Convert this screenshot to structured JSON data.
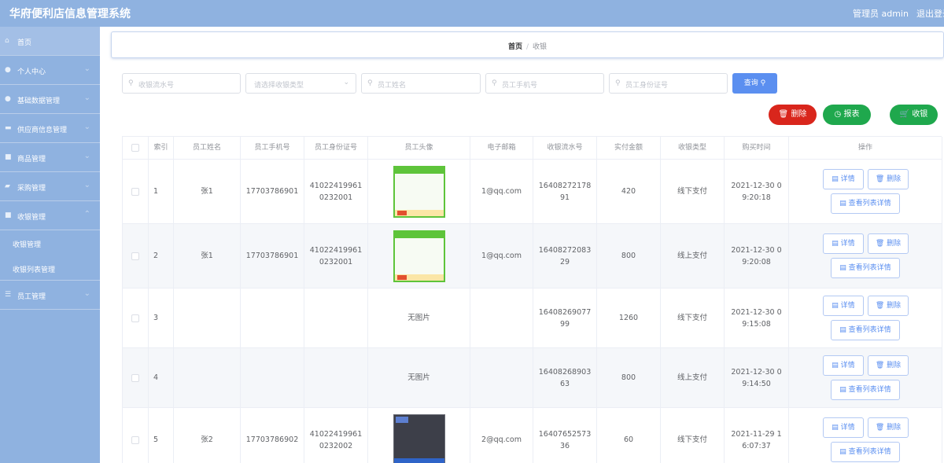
{
  "header": {
    "title": "华府便利店信息管理系统",
    "user": "管理员 admin",
    "logout": "退出登录"
  },
  "sidebar": {
    "items": [
      {
        "label": "首页"
      },
      {
        "label": "个人中心"
      },
      {
        "label": "基础数据管理"
      },
      {
        "label": "供应商信息管理"
      },
      {
        "label": "商品管理"
      },
      {
        "label": "采购管理"
      },
      {
        "label": "收银管理"
      },
      {
        "label": "员工管理"
      }
    ],
    "sub_items": [
      {
        "label": "收银管理"
      },
      {
        "label": "收银列表管理"
      }
    ]
  },
  "breadcrumb": {
    "home": "首页",
    "separator": "/",
    "current": "收银"
  },
  "search": {
    "serial_placeholder": "收银流水号",
    "type_placeholder": "请选择收银类型",
    "name_placeholder": "员工姓名",
    "phone_placeholder": "员工手机号",
    "id_placeholder": "员工身份证号",
    "query_label": "查询"
  },
  "toolbar": {
    "delete_label": "删除",
    "report_label": "报表",
    "pay_label": "收银"
  },
  "table": {
    "columns": [
      "索引",
      "员工姓名",
      "员工手机号",
      "员工身份证号",
      "员工头像",
      "电子邮箱",
      "收银流水号",
      "实付金额",
      "收银类型",
      "购买时间",
      "操作"
    ],
    "rows": [
      {
        "index": "1",
        "name": "张1",
        "phone": "17703786901",
        "id_card": "410224199610232001",
        "avatar": "",
        "email": "1@qq.com",
        "serial": "1640827217891",
        "amount": "420",
        "type": "线下支付",
        "time": "2021-12-30 09:20:18"
      },
      {
        "index": "2",
        "name": "张1",
        "phone": "17703786901",
        "id_card": "410224199610232001",
        "avatar": "",
        "email": "1@qq.com",
        "serial": "1640827208329",
        "amount": "800",
        "type": "线上支付",
        "time": "2021-12-30 09:20:08"
      },
      {
        "index": "3",
        "name": "",
        "phone": "",
        "id_card": "",
        "avatar": "无图片",
        "email": "",
        "serial": "1640826907799",
        "amount": "1260",
        "type": "线下支付",
        "time": "2021-12-30 09:15:08"
      },
      {
        "index": "4",
        "name": "",
        "phone": "",
        "id_card": "",
        "avatar": "无图片",
        "email": "",
        "serial": "1640826890363",
        "amount": "800",
        "type": "线上支付",
        "time": "2021-12-30 09:14:50"
      },
      {
        "index": "5",
        "name": "张2",
        "phone": "17703786902",
        "id_card": "410224199610232002",
        "avatar": "",
        "email": "2@qq.com",
        "serial": "1640765257336",
        "amount": "60",
        "type": "线下支付",
        "time": "2021-11-29 16:07:37"
      }
    ],
    "actions": {
      "detail": "详情",
      "delete": "删除",
      "list_detail": "查看列表详情"
    }
  },
  "colors": {
    "primary": "#5b8ff0",
    "danger": "#d9261c",
    "success": "#1fa84d",
    "sidebar": "#8fb2e0"
  }
}
